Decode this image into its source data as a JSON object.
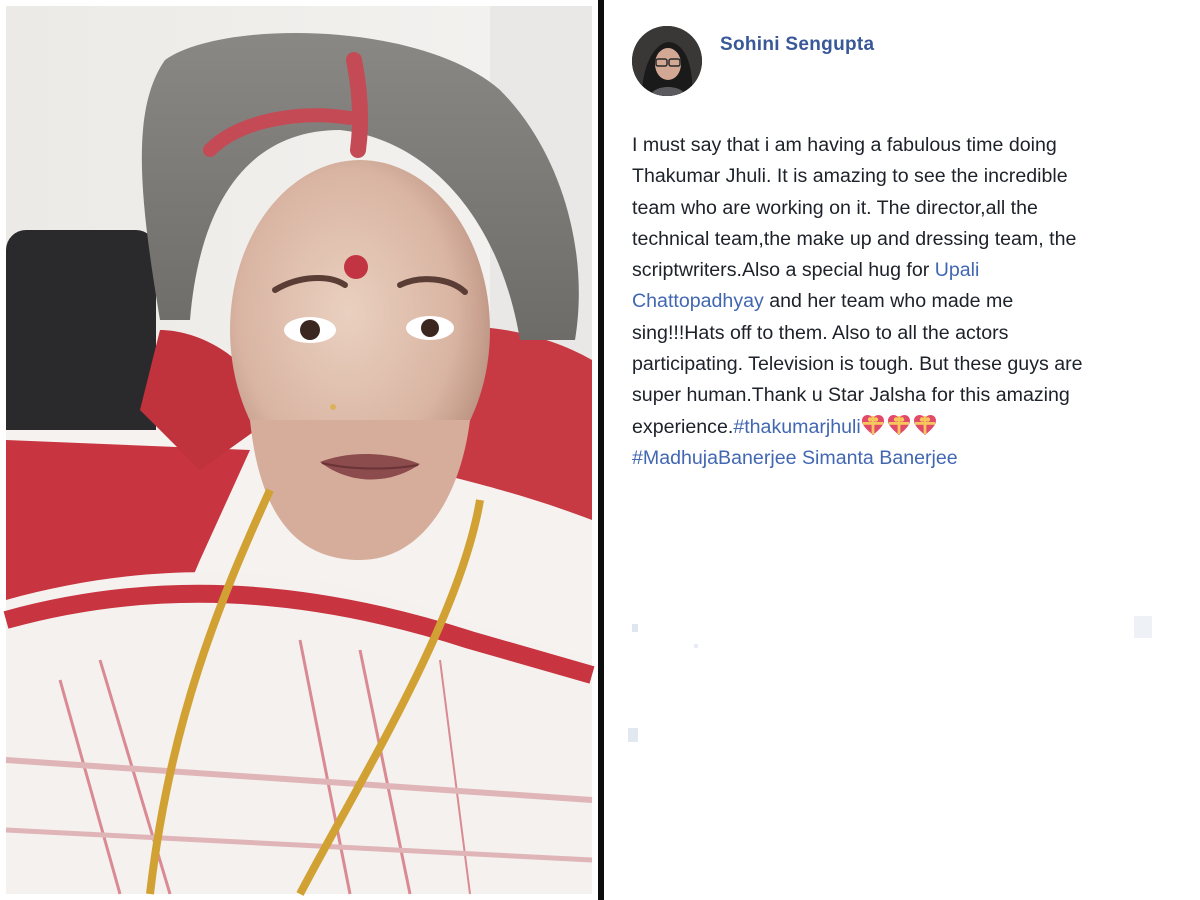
{
  "post": {
    "author_name": "Sohini Sengupta",
    "lines": [
      {
        "segments": [
          {
            "text": "I must say that i am having a fabulous time doing",
            "kind": "text"
          }
        ]
      },
      {
        "segments": [
          {
            "text": "Thakumar Jhuli. It is amazing to see the incredible",
            "kind": "text"
          }
        ]
      },
      {
        "segments": [
          {
            "text": "team who are working on it. The director,all the",
            "kind": "text"
          }
        ]
      },
      {
        "segments": [
          {
            "text": "technical team,the make up and dressing team, the",
            "kind": "text"
          }
        ]
      },
      {
        "segments": [
          {
            "text": "scriptwriters.Also a special hug for ",
            "kind": "text"
          },
          {
            "text": "Upali",
            "kind": "link"
          }
        ]
      },
      {
        "segments": [
          {
            "text": "Chattopadhyay",
            "kind": "link"
          },
          {
            "text": " and her team who made me",
            "kind": "text"
          }
        ]
      },
      {
        "segments": [
          {
            "text": "sing!!!Hats off to them. Also to all the actors",
            "kind": "text"
          }
        ]
      },
      {
        "segments": [
          {
            "text": "participating. Television is tough. But these guys are",
            "kind": "text"
          }
        ]
      },
      {
        "segments": [
          {
            "text": "super human.Thank u Star Jalsha for this amazing",
            "kind": "text"
          }
        ]
      },
      {
        "segments": [
          {
            "text": "experience.",
            "kind": "text"
          },
          {
            "text": "#thakumarjhuli",
            "kind": "link"
          },
          {
            "text": "",
            "kind": "hearts"
          }
        ]
      },
      {
        "segments": [
          {
            "text": "#MadhujaBanerjee",
            "kind": "link"
          },
          {
            "text": " ",
            "kind": "text"
          },
          {
            "text": "Simanta Banerjee",
            "kind": "link"
          }
        ]
      }
    ],
    "heart_emoji_count": 3
  },
  "icons": {
    "heart": "gift-heart-emoji-icon",
    "avatar": "profile-avatar"
  },
  "colors": {
    "author": "#385898",
    "link": "#4267b2",
    "text": "#1d2129",
    "divider": "#0d0d0d"
  }
}
